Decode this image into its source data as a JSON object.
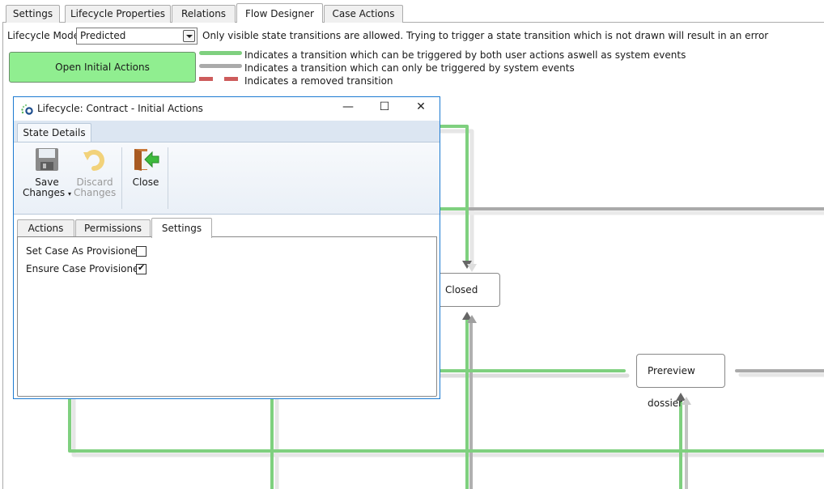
{
  "main_tabs": [
    {
      "label": "Settings",
      "active": false
    },
    {
      "label": "Lifecycle Properties",
      "active": false
    },
    {
      "label": "Relations",
      "active": false
    },
    {
      "label": "Flow Designer",
      "active": true
    },
    {
      "label": "Case Actions",
      "active": false
    }
  ],
  "lifecycle_mode": {
    "label": "Lifecycle Mode",
    "selected": "Predicted",
    "hint": "Only visible state transitions are allowed. Trying to trigger a state transition which is not drawn will result in an error"
  },
  "open_initial_actions_label": "Open Initial Actions",
  "legend": [
    {
      "color": "#7fd07f",
      "style": "solid",
      "text": "Indicates a transition which can be triggered by both user actions aswell as system events"
    },
    {
      "color": "#aaaaaa",
      "style": "solid",
      "text": "Indicates a transition which can only be triggered by system events"
    },
    {
      "color": "#cd5c5c",
      "style": "dashed",
      "text": "Indicates a removed transition"
    }
  ],
  "colors": {
    "user_and_system": "#7fd07f",
    "system_only": "#aaaaaa",
    "removed": "#cd5c5c",
    "accent_border": "#1c7ad1",
    "button_green": "#90ee90"
  },
  "states": [
    {
      "name": "Closed"
    },
    {
      "name": "Prereview dossier"
    }
  ],
  "dialog": {
    "title": "Lifecycle: Contract - Initial Actions",
    "window_controls": {
      "minimize": "—",
      "maximize": "☐",
      "close": "✕"
    },
    "ribbon_tab": "State Details",
    "ribbon_buttons": [
      {
        "line1": "Save",
        "line2": "Changes",
        "icon": "floppy-disk-icon",
        "enabled": true,
        "has_dropdown": true
      },
      {
        "line1": "Discard",
        "line2": "Changes",
        "icon": "undo-icon",
        "enabled": false,
        "has_dropdown": false
      },
      {
        "line1": "Close",
        "line2": "",
        "icon": "exit-door-icon",
        "enabled": true,
        "has_dropdown": false
      }
    ],
    "inner_tabs": [
      {
        "label": "Actions",
        "active": false
      },
      {
        "label": "Permissions",
        "active": false
      },
      {
        "label": "Settings",
        "active": true
      }
    ],
    "settings": [
      {
        "label": "Set Case As Provisioned",
        "checked": false
      },
      {
        "label": "Ensure Case Provisioned",
        "checked": true
      }
    ]
  }
}
